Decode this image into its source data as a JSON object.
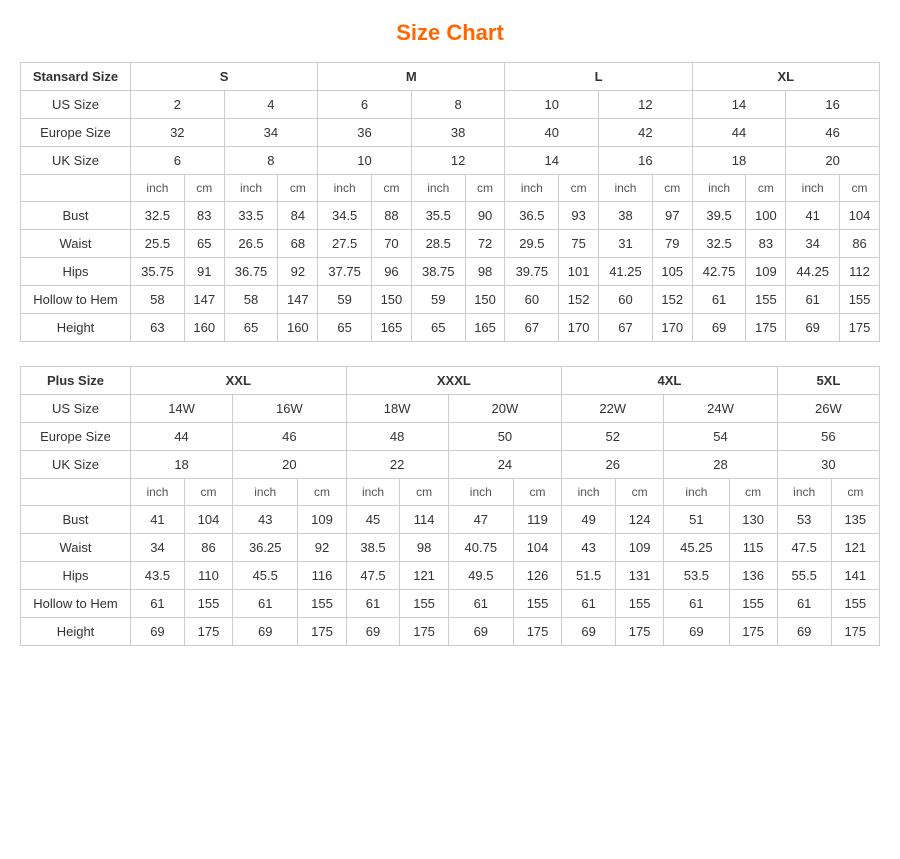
{
  "title": "Size Chart",
  "standard": {
    "sectionLabel": "Stansard Size",
    "sizeGroups": [
      "S",
      "M",
      "L",
      "XL"
    ],
    "usLabel": "US Size",
    "usValues": [
      "2",
      "4",
      "6",
      "8",
      "10",
      "12",
      "14",
      "16"
    ],
    "euroLabel": "Europe Size",
    "euroValues": [
      "32",
      "34",
      "36",
      "38",
      "40",
      "42",
      "44",
      "46"
    ],
    "ukLabel": "UK Size",
    "ukValues": [
      "6",
      "8",
      "10",
      "12",
      "14",
      "16",
      "18",
      "20"
    ],
    "unitInch": "inch",
    "unitCm": "cm",
    "measurements": [
      {
        "label": "Bust",
        "values": [
          "32.5",
          "83",
          "33.5",
          "84",
          "34.5",
          "88",
          "35.5",
          "90",
          "36.5",
          "93",
          "38",
          "97",
          "39.5",
          "100",
          "41",
          "104"
        ]
      },
      {
        "label": "Waist",
        "values": [
          "25.5",
          "65",
          "26.5",
          "68",
          "27.5",
          "70",
          "28.5",
          "72",
          "29.5",
          "75",
          "31",
          "79",
          "32.5",
          "83",
          "34",
          "86"
        ]
      },
      {
        "label": "Hips",
        "values": [
          "35.75",
          "91",
          "36.75",
          "92",
          "37.75",
          "96",
          "38.75",
          "98",
          "39.75",
          "101",
          "41.25",
          "105",
          "42.75",
          "109",
          "44.25",
          "112"
        ]
      },
      {
        "label": "Hollow to Hem",
        "values": [
          "58",
          "147",
          "58",
          "147",
          "59",
          "150",
          "59",
          "150",
          "60",
          "152",
          "60",
          "152",
          "61",
          "155",
          "61",
          "155"
        ]
      },
      {
        "label": "Height",
        "values": [
          "63",
          "160",
          "65",
          "160",
          "65",
          "165",
          "65",
          "165",
          "67",
          "170",
          "67",
          "170",
          "69",
          "175",
          "69",
          "175"
        ]
      }
    ]
  },
  "plus": {
    "sectionLabel": "Plus Size",
    "sizeGroups": [
      "XXL",
      "XXXL",
      "4XL",
      "5XL"
    ],
    "usLabel": "US Size",
    "usValues": [
      "14W",
      "16W",
      "18W",
      "20W",
      "22W",
      "24W",
      "26W"
    ],
    "euroLabel": "Europe Size",
    "euroValues": [
      "44",
      "46",
      "48",
      "50",
      "52",
      "54",
      "56"
    ],
    "ukLabel": "UK Size",
    "ukValues": [
      "18",
      "20",
      "22",
      "24",
      "26",
      "28",
      "30"
    ],
    "unitInch": "inch",
    "unitCm": "cm",
    "measurements": [
      {
        "label": "Bust",
        "values": [
          "41",
          "104",
          "43",
          "109",
          "45",
          "114",
          "47",
          "119",
          "49",
          "124",
          "51",
          "130",
          "53",
          "135"
        ]
      },
      {
        "label": "Waist",
        "values": [
          "34",
          "86",
          "36.25",
          "92",
          "38.5",
          "98",
          "40.75",
          "104",
          "43",
          "109",
          "45.25",
          "115",
          "47.5",
          "121"
        ]
      },
      {
        "label": "Hips",
        "values": [
          "43.5",
          "110",
          "45.5",
          "116",
          "47.5",
          "121",
          "49.5",
          "126",
          "51.5",
          "131",
          "53.5",
          "136",
          "55.5",
          "141"
        ]
      },
      {
        "label": "Hollow to Hem",
        "values": [
          "61",
          "155",
          "61",
          "155",
          "61",
          "155",
          "61",
          "155",
          "61",
          "155",
          "61",
          "155",
          "61",
          "155"
        ]
      },
      {
        "label": "Height",
        "values": [
          "69",
          "175",
          "69",
          "175",
          "69",
          "175",
          "69",
          "175",
          "69",
          "175",
          "69",
          "175",
          "69",
          "175"
        ]
      }
    ]
  }
}
